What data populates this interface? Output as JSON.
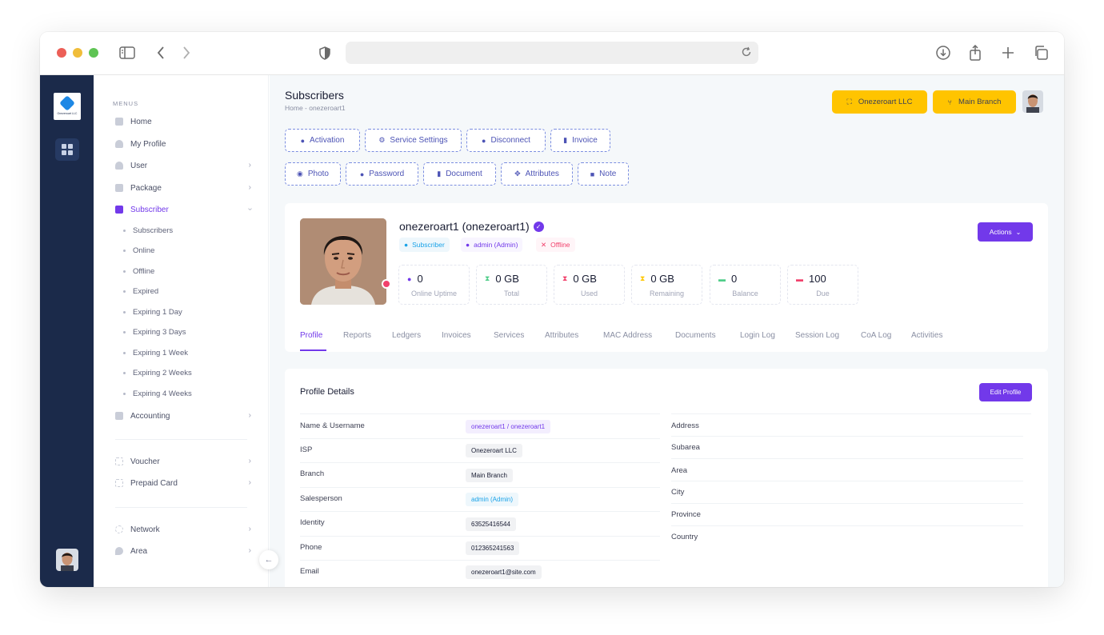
{
  "sidebar": {
    "section_title": "MENUS",
    "items": [
      {
        "label": "Home"
      },
      {
        "label": "My Profile"
      },
      {
        "label": "User"
      },
      {
        "label": "Package"
      },
      {
        "label": "Subscriber"
      },
      {
        "label": "Accounting"
      },
      {
        "label": "Voucher"
      },
      {
        "label": "Prepaid Card"
      },
      {
        "label": "Network"
      },
      {
        "label": "Area"
      }
    ],
    "subscriber_children": [
      "Subscribers",
      "Online",
      "Offline",
      "Expired",
      "Expiring 1 Day",
      "Expiring 3 Days",
      "Expiring 1 Week",
      "Expiring 2 Weeks",
      "Expiring 4 Weeks"
    ]
  },
  "header": {
    "title": "Subscribers",
    "breadcrumb": "Home  -  onezeroart1",
    "company_button": "Onezeroart LLC",
    "branch_button": "Main Branch"
  },
  "toolbar": {
    "row1": [
      "Activation",
      "Service Settings",
      "Disconnect",
      "Invoice"
    ],
    "row2": [
      "Photo",
      "Password",
      "Document",
      "Attributes",
      "Note"
    ]
  },
  "profile": {
    "name": "onezeroart1 (onezeroart1)",
    "tags": [
      "Subscriber",
      "admin (Admin)",
      "Offline"
    ],
    "actions_label": "Actions",
    "stats": [
      {
        "value": "0",
        "label": "Online Uptime",
        "color": "#7239ea"
      },
      {
        "value": "0 GB",
        "label": "Total",
        "color": "#50cd89"
      },
      {
        "value": "0 GB",
        "label": "Used",
        "color": "#f1416c"
      },
      {
        "value": "0 GB",
        "label": "Remaining",
        "color": "#ffc700"
      },
      {
        "value": "0",
        "label": "Balance",
        "color": "#50cd89"
      },
      {
        "value": "100",
        "label": "Due",
        "color": "#f1416c"
      }
    ],
    "tabs": [
      "Profile",
      "Reports",
      "Ledgers",
      "Invoices",
      "Services",
      "Attributes",
      "MAC Address",
      "Documents",
      "Login Log",
      "Session Log",
      "CoA Log",
      "Activities"
    ]
  },
  "details": {
    "title": "Profile Details",
    "edit_label": "Edit Profile",
    "left": [
      {
        "label": "Name & Username",
        "value": "onezeroart1 / onezeroart1"
      },
      {
        "label": "ISP",
        "value": "Onezeroart LLC"
      },
      {
        "label": "Branch",
        "value": "Main Branch"
      },
      {
        "label": "Salesperson",
        "value": "admin (Admin)"
      },
      {
        "label": "Identity",
        "value": "63525416544"
      },
      {
        "label": "Phone",
        "value": "012365241563"
      },
      {
        "label": "Email",
        "value": "onezeroart1@site.com"
      }
    ],
    "right": [
      {
        "label": "Address"
      },
      {
        "label": "Subarea"
      },
      {
        "label": "Area"
      },
      {
        "label": "City"
      },
      {
        "label": "Province"
      },
      {
        "label": "Country"
      }
    ]
  },
  "brand": {
    "logo_text": "Onezeroart LLC"
  },
  "colors": {
    "accent": "#7239ea",
    "warning": "#ffc400",
    "rail": "#1b2a4a",
    "danger": "#f1416c"
  }
}
